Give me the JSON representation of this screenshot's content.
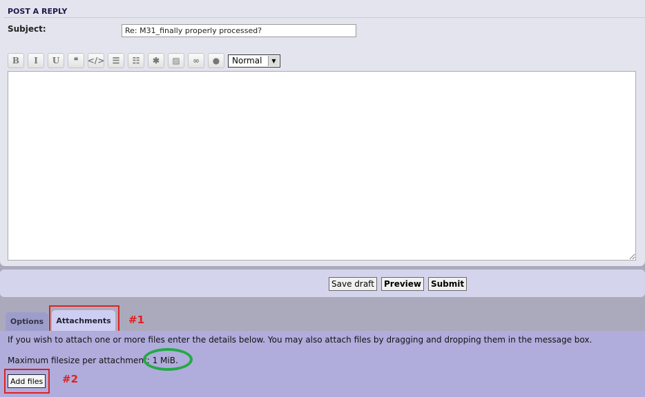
{
  "header": {
    "title": "POST A REPLY"
  },
  "subject": {
    "label": "Subject:",
    "value": "Re: M31_finally properly processed?"
  },
  "toolbar": {
    "buttons": [
      {
        "name": "bold",
        "glyph": "B"
      },
      {
        "name": "italic",
        "glyph": "I"
      },
      {
        "name": "underline",
        "glyph": "U"
      },
      {
        "name": "quote",
        "glyph": "❝"
      },
      {
        "name": "code",
        "glyph": "</>"
      },
      {
        "name": "list",
        "glyph": "☰"
      },
      {
        "name": "numbered-list",
        "glyph": "☷"
      },
      {
        "name": "list-item",
        "glyph": "✱"
      },
      {
        "name": "image",
        "glyph": "▨"
      },
      {
        "name": "link",
        "glyph": "∞"
      },
      {
        "name": "color",
        "glyph": "●"
      }
    ],
    "font_size": "Normal"
  },
  "actions": {
    "save_draft": "Save draft",
    "preview": "Preview",
    "submit": "Submit"
  },
  "tabs": {
    "options": "Options",
    "attachments": "Attachments"
  },
  "attachments": {
    "info": "If you wish to attach one or more files enter the details below. You may also attach files by dragging and dropping them in the message box.",
    "max_size": "Maximum filesize per attachment: 1 MiB.",
    "add_files": "Add files"
  },
  "annotations": {
    "label1": "#1",
    "label2": "#2",
    "red": "#e02020",
    "green": "#22aa44"
  }
}
